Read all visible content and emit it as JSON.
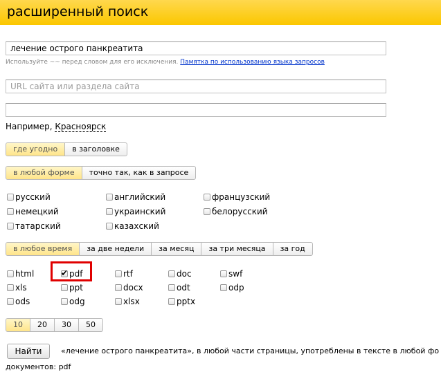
{
  "header": {
    "title": "расширенный поиск"
  },
  "query": {
    "value": "лечение острого панкреатита",
    "hint": "Используйте ~~ перед словом для его исключения.",
    "hint_link": "Памятка по использованию языка запросов"
  },
  "site": {
    "placeholder": "URL сайта или раздела сайта",
    "value": ""
  },
  "region": {
    "value": "",
    "example_prefix": "Например,",
    "example_city": "Красноярск"
  },
  "position": {
    "options": [
      "где угодно",
      "в заголовке"
    ],
    "selected": "где угодно"
  },
  "form": {
    "options": [
      "в любой форме",
      "точно так, как в запросе"
    ],
    "selected": "в любой форме"
  },
  "languages": [
    {
      "label": "русский",
      "checked": false
    },
    {
      "label": "английский",
      "checked": false
    },
    {
      "label": "французский",
      "checked": false
    },
    {
      "label": "немецкий",
      "checked": false
    },
    {
      "label": "украинский",
      "checked": false
    },
    {
      "label": "белорусский",
      "checked": false
    },
    {
      "label": "татарский",
      "checked": false
    },
    {
      "label": "казахский",
      "checked": false
    }
  ],
  "time": {
    "options": [
      "в любое время",
      "за две недели",
      "за месяц",
      "за три месяца",
      "за год"
    ],
    "selected": "в любое время"
  },
  "formats": [
    {
      "label": "html",
      "checked": false
    },
    {
      "label": "pdf",
      "checked": true
    },
    {
      "label": "rtf",
      "checked": false
    },
    {
      "label": "doc",
      "checked": false
    },
    {
      "label": "swf",
      "checked": false
    },
    {
      "label": "xls",
      "checked": false
    },
    {
      "label": "ppt",
      "checked": false
    },
    {
      "label": "docx",
      "checked": false
    },
    {
      "label": "odt",
      "checked": false
    },
    {
      "label": "odp",
      "checked": false
    },
    {
      "label": "ods",
      "checked": false
    },
    {
      "label": "odg",
      "checked": false
    },
    {
      "label": "xlsx",
      "checked": false
    },
    {
      "label": "pptx",
      "checked": false
    }
  ],
  "results_per_page": {
    "options": [
      "10",
      "20",
      "30",
      "50"
    ],
    "selected": "10"
  },
  "search_button": {
    "label": "Найти"
  },
  "summary": {
    "line1": "«лечение острого панкреатита», в любой части страницы, употреблены в тексте в любой фо",
    "line2": "документов: pdf"
  },
  "colors": {
    "header": "#fbc700",
    "active_segment": "#ffe58a",
    "link": "#0033cc",
    "highlight": "#e00000"
  }
}
